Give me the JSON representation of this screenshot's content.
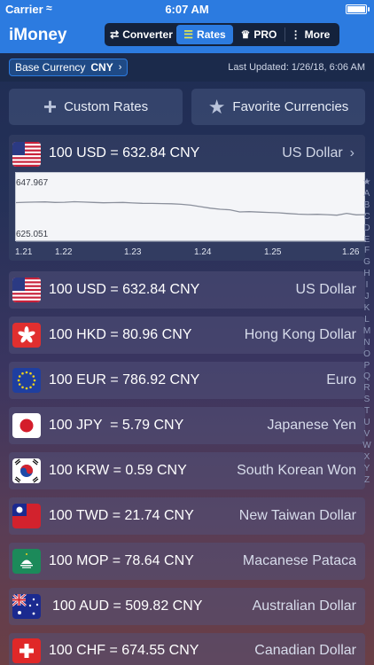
{
  "status": {
    "carrier": "Carrier",
    "time": "6:07 AM"
  },
  "app": {
    "title": "iMoney"
  },
  "segments": [
    {
      "label": "Converter",
      "icon": "convert-icon"
    },
    {
      "label": "Rates",
      "icon": "list-icon"
    },
    {
      "label": "PRO",
      "icon": "crown-icon"
    },
    {
      "label": "More",
      "icon": "more-icon"
    }
  ],
  "base": {
    "label": "Base Currency",
    "code": "CNY"
  },
  "last_updated": "Last Updated: 1/26/18, 6:06 AM",
  "actions": {
    "custom": "Custom Rates",
    "favorite": "Favorite Currencies"
  },
  "chart_header": {
    "text": "100 USD = 632.84 CNY",
    "name": "US Dollar"
  },
  "chart_data": {
    "type": "line",
    "x": [
      "1.21",
      "1.22",
      "1.23",
      "1.24",
      "1.25",
      "1.26"
    ],
    "tick_labels": [
      "1.21",
      "1.22",
      "1.23",
      "1.24",
      "1.25",
      "1.26"
    ],
    "ylim": [
      625.051,
      647.967
    ],
    "y_labels": [
      "647.967",
      "625.051"
    ],
    "values": [
      639.9,
      640.1,
      640.2,
      640.3,
      640.0,
      640.1,
      640.4,
      640.2,
      640.0,
      639.8,
      639.9,
      640.0,
      639.7,
      639.5,
      639.4,
      639.3,
      639.2,
      638.9,
      638.4,
      637.5,
      636.6,
      636.0,
      635.7,
      634.4,
      634.6,
      634.3,
      634.1,
      633.9,
      633.5,
      633.1,
      632.9,
      633.0,
      632.8,
      632.5,
      633.6,
      632.7,
      632.8
    ]
  },
  "rates": [
    {
      "amount": "100 USD = 632.84 CNY",
      "name": "US Dollar",
      "flag": "us"
    },
    {
      "amount": "100 HKD = 80.96 CNY",
      "name": "Hong Kong Dollar",
      "flag": "hk"
    },
    {
      "amount": "100 EUR = 786.92 CNY",
      "name": "Euro",
      "flag": "eu"
    },
    {
      "amount": "100 JPY  = 5.79 CNY",
      "name": "Japanese Yen",
      "flag": "jp"
    },
    {
      "amount": "100 KRW = 0.59 CNY",
      "name": "South Korean Won",
      "flag": "kr"
    },
    {
      "amount": "100 TWD = 21.74 CNY",
      "name": "New Taiwan Dollar",
      "flag": "tw"
    },
    {
      "amount": "100 MOP = 78.64 CNY",
      "name": "Macanese Pataca",
      "flag": "mo"
    },
    {
      "amount": "100 AUD = 509.82 CNY",
      "name": "Australian Dollar",
      "flag": "au"
    },
    {
      "amount": "100 CHF = 674.55 CNY",
      "name": "Canadian Dollar",
      "flag": "ch"
    }
  ],
  "index_letters": [
    "★",
    "A",
    "B",
    "C",
    "D",
    "E",
    "F",
    "G",
    "H",
    "I",
    "J",
    "K",
    "L",
    "M",
    "N",
    "O",
    "P",
    "Q",
    "R",
    "S",
    "T",
    "U",
    "V",
    "W",
    "X",
    "Y",
    "Z"
  ]
}
